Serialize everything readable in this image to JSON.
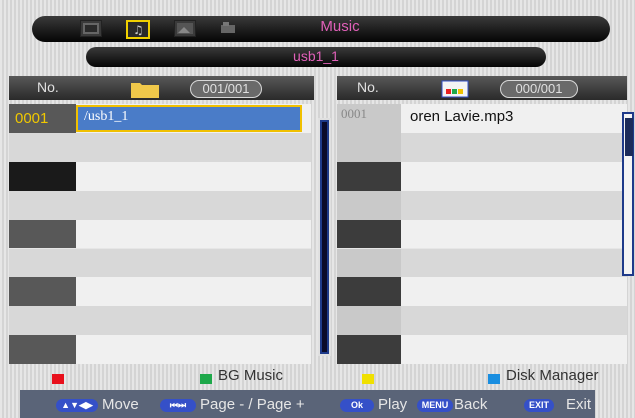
{
  "header": {
    "title": "Music",
    "path": "usb1_1",
    "icons": [
      "film-icon",
      "music-note-icon",
      "photo-icon",
      "text-icon"
    ]
  },
  "left_panel": {
    "no_label": "No.",
    "counter": "001/001",
    "folder_icon": "folder-icon",
    "rows": [
      {
        "num": "0001",
        "name": "/usb1_1",
        "selected": true
      }
    ]
  },
  "right_panel": {
    "no_label": "No.",
    "counter": "000/001",
    "icon": "usb-drive-icon",
    "rows": [
      {
        "num": "0001",
        "name": "oren Lavie.mp3"
      }
    ]
  },
  "legend": {
    "red_label": "",
    "green_label": "BG Music",
    "yellow_label": "",
    "blue_label": "Disk Manager",
    "colors": {
      "red": "#e8101c",
      "green": "#1ea84a",
      "yellow": "#f0e000",
      "blue": "#1a8ee0"
    }
  },
  "footer": {
    "move": "Move",
    "page_key": "⏮⏭",
    "page": "Page - / Page +",
    "ok_key": "Ok",
    "play": "Play",
    "menu_key": "MENU",
    "back": "Back",
    "exit_key": "EXIT",
    "exit": "Exit"
  }
}
